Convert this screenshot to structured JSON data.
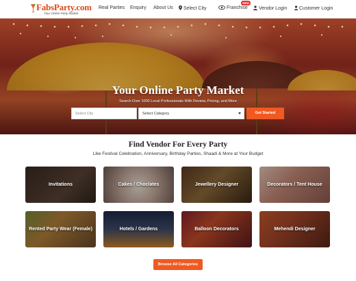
{
  "header": {
    "logo_text": "FabsParty.com",
    "logo_tagline": "Your Online Party Market",
    "nav": {
      "real_parties": "Real Parties",
      "enquiry": "Enquiry",
      "about_us": "About Us",
      "select_city": "Select City",
      "franchise": "Franchise",
      "franchise_badge": "New",
      "vendor_login": "Vendor Login",
      "customer_login": "Customer Login"
    }
  },
  "hero": {
    "title": "Your Online Party Market",
    "subtitle": "Search Over 1000 Local Professionals With Review, Pricing, and More",
    "city_placeholder": "Select City",
    "category_placeholder": "Select Category",
    "cta": "Get Started"
  },
  "section": {
    "title": "Find Vendor For Every Party",
    "subtitle": "Like Festival Celebration, Anniversary, Birthday Parties, Shaadi & More at Your Budget"
  },
  "categories": [
    "Invitations",
    "Cakes / Choclates",
    "Jewellery Designer",
    "Decorators / Tent House",
    "Rented Party Wear (Female)",
    "Hotels / Gardens",
    "Balloon Decorators",
    "Mehendi Designer"
  ],
  "browse_label": "Browse All Categories",
  "colors": {
    "accent": "#f05a22",
    "logo": "#d64b1a",
    "badge": "#e53935"
  }
}
